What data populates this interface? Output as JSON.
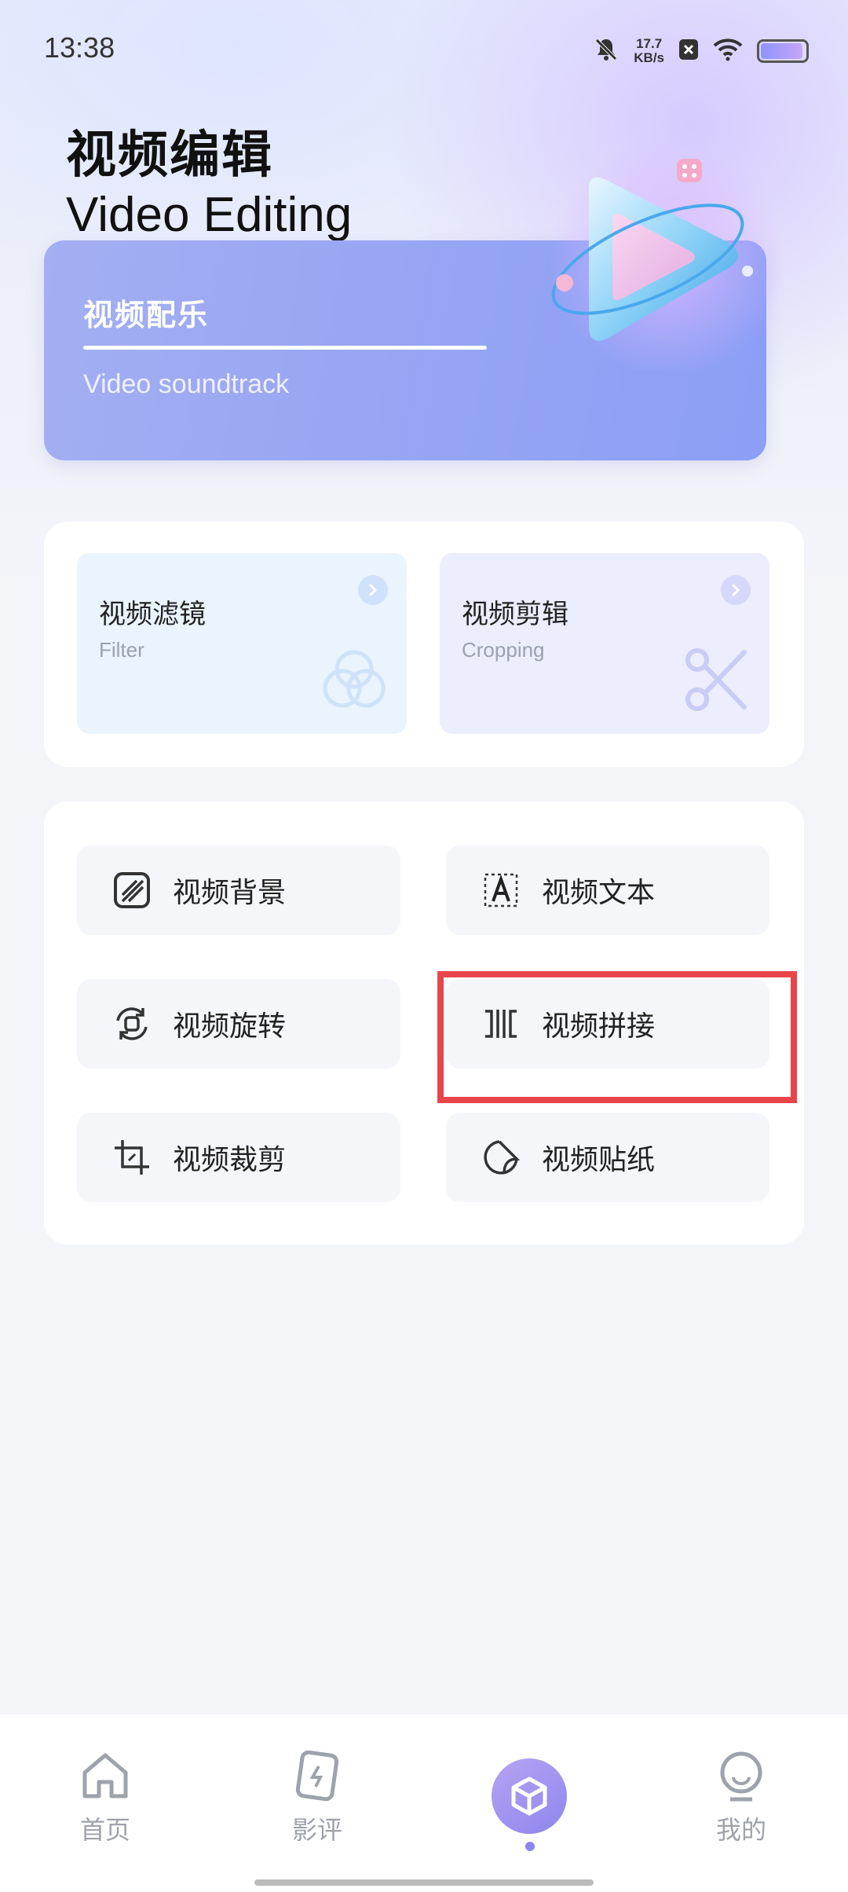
{
  "status_bar": {
    "time": "13:38",
    "net_speed_value": "17.7",
    "net_speed_unit": "KB/s",
    "battery_level": 0.95,
    "icons": [
      "bell-mute-icon",
      "close-box-icon",
      "wifi-icon",
      "battery-icon"
    ]
  },
  "header": {
    "title_cn": "视频编辑",
    "title_en": "Video Editing"
  },
  "banner": {
    "title": "视频配乐",
    "subtitle": "Video soundtrack"
  },
  "features": [
    {
      "title": "视频滤镜",
      "subtitle": "Filter",
      "icon": "filter-circles-icon"
    },
    {
      "title": "视频剪辑",
      "subtitle": "Cropping",
      "icon": "scissors-icon"
    }
  ],
  "tools": [
    {
      "label": "视频背景",
      "icon": "background-icon"
    },
    {
      "label": "视频文本",
      "icon": "text-icon"
    },
    {
      "label": "视频旋转",
      "icon": "rotate-icon"
    },
    {
      "label": "视频拼接",
      "icon": "splice-icon"
    },
    {
      "label": "视频裁剪",
      "icon": "crop-icon"
    },
    {
      "label": "视频贴纸",
      "icon": "sticker-icon"
    }
  ],
  "highlight_color": "#e8454b",
  "nav": [
    {
      "label": "首页",
      "icon": "home-icon"
    },
    {
      "label": "影评",
      "icon": "review-card-icon"
    },
    {
      "label": "",
      "icon": "cube-icon",
      "active": true
    },
    {
      "label": "我的",
      "icon": "profile-icon"
    }
  ],
  "accent_color": "#8e86ee"
}
